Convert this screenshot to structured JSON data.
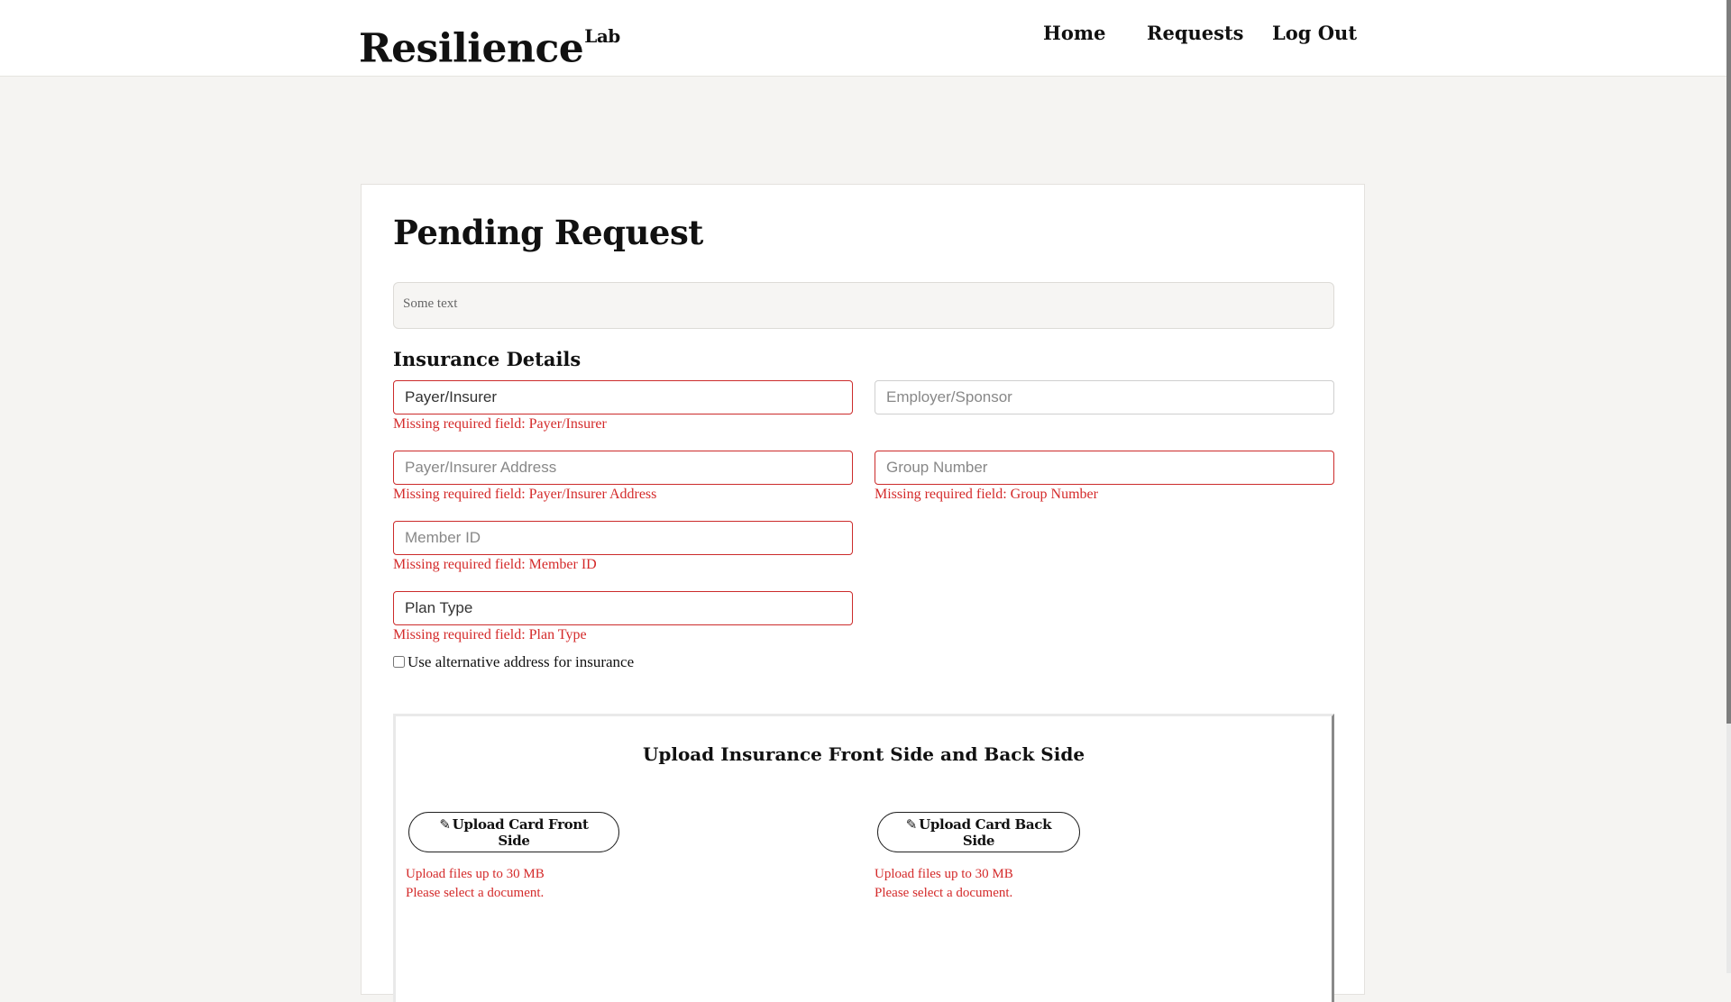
{
  "header": {
    "logo_main": "Resilience",
    "logo_sup": "Lab",
    "nav": {
      "home": "Home",
      "requests": "Requests",
      "logout": "Log Out"
    }
  },
  "page": {
    "title": "Pending Request",
    "notes_text": "Some text"
  },
  "insurance": {
    "section_title": "Insurance Details",
    "payer": {
      "placeholder": "Payer/Insurer",
      "error": "Missing required field: Payer/Insurer"
    },
    "employer": {
      "placeholder": "Employer/Sponsor"
    },
    "payer_address": {
      "placeholder": "Payer/Insurer Address",
      "error": "Missing required field: Payer/Insurer Address"
    },
    "group_number": {
      "placeholder": "Group Number",
      "error": "Missing required field: Group Number"
    },
    "member_id": {
      "placeholder": "Member ID",
      "error": "Missing required field: Member ID"
    },
    "plan_type": {
      "placeholder": "Plan Type",
      "error": "Missing required field: Plan Type"
    },
    "alt_address_label": "Use alternative address for insurance",
    "alt_address_checked": false
  },
  "upload": {
    "title": "Upload Insurance Front Side and Back Side",
    "clip_icon": "✎",
    "front": {
      "label": "Upload Card Front Side",
      "limit": "Upload files up to 30 MB",
      "status": "Please select a document."
    },
    "back": {
      "label": "Upload Card Back Side",
      "limit": "Upload files up to 30 MB",
      "status": "Please select a document."
    }
  }
}
